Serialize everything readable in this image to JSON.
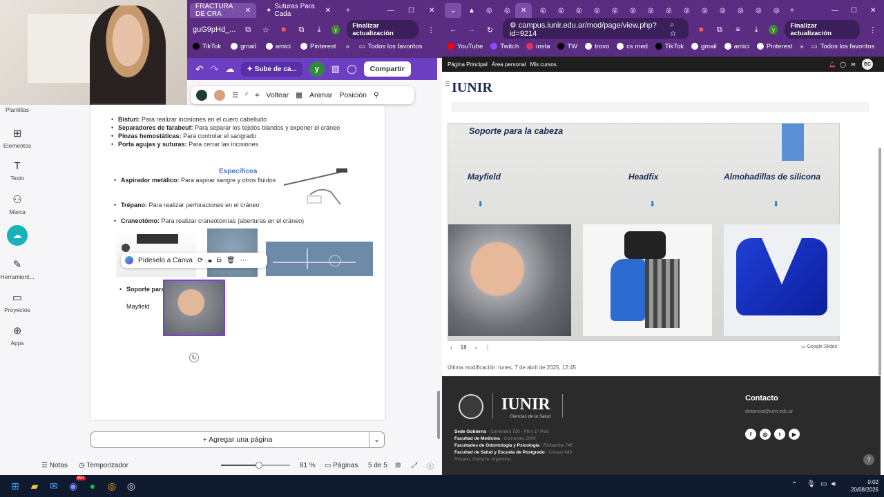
{
  "left_browser": {
    "tabs": [
      {
        "label": "FRACTURA DE CRÁ",
        "active": true
      },
      {
        "label": "Suturas Para Cada",
        "active": false
      }
    ],
    "url_fragment": "guG9pHd_...",
    "update_button": "Finalizar actualización",
    "bookmarks": [
      "TikTok",
      "gmail",
      "amici",
      "Pinterest"
    ],
    "all_bookmarks": "Todos los favoritos"
  },
  "canva": {
    "sube_label": "Sube de ca...",
    "avatar_letter": "y",
    "share_button": "Compartir",
    "toolbar": {
      "flip": "Voltear",
      "animate": "Animar",
      "position": "Posición"
    },
    "colors": [
      "#1f3d33",
      "#d9a07c"
    ],
    "sidebar": [
      {
        "label": "Plantillas",
        "icon": "templates-icon"
      },
      {
        "label": "Elementos",
        "icon": "elements-icon"
      },
      {
        "label": "Texto",
        "icon": "text-icon"
      },
      {
        "label": "Marca",
        "icon": "brand-icon"
      },
      {
        "label": "Herramient...",
        "icon": "tools-icon"
      },
      {
        "label": "Proyectos",
        "icon": "folder-icon"
      },
      {
        "label": "Apps",
        "icon": "apps-icon"
      }
    ],
    "doc": {
      "tools": [
        {
          "term": "Bisturí:",
          "desc": "Para realizar incisiones en el cuero cabelludo"
        },
        {
          "term": "Separadores de farabeuf:",
          "desc": "Para separar los tejidos blandos y exponer el cráneo"
        },
        {
          "term": "Pinzas hemostáticas:",
          "desc": "Para controlar el sangrado"
        },
        {
          "term": "Porta agujas y suturas:",
          "desc": "Para cerrar las incisiones"
        }
      ],
      "specific_heading": "Específicos",
      "specific": [
        {
          "term": "Aspirador metálico:",
          "desc": "Para aspirar sangre y otros fluidos"
        },
        {
          "term": "Trépano:",
          "desc": "Para realizar perforaciones en el cráneo"
        },
        {
          "term": "Craneotómo:",
          "desc": "Para realizar craneotomías (aberturas en el cráneo)"
        }
      ],
      "support_heading": "Soporte para la cabeza",
      "mayfield": "Mayfield"
    },
    "ask_canva": "Pídeselo a Canva",
    "add_page": "+ Agregar una página",
    "status": {
      "notes": "Notas",
      "timer": "Temporizador",
      "zoom": "81 %",
      "zoom_value": 0.81,
      "pages_label": "Páginas",
      "pages": "5 de 5"
    }
  },
  "right_browser": {
    "url": "campus.iunir.edu.ar/mod/page/view.php?id=9214",
    "update_button": "Finalizar actualización",
    "bookmarks": [
      "YouTube",
      "Twitch",
      "insta",
      "TW",
      "trovo",
      "cs med",
      "TikTok",
      "gmail",
      "amici",
      "Pinterest"
    ],
    "all_bookmarks": "Todos los favoritos",
    "nav": [
      "Página Principal",
      "Área personal",
      "Mis cursos"
    ],
    "user_initials": "BC",
    "logo": "IUNIR",
    "slide": {
      "title": "Soporte para la cabeza",
      "labels": [
        "Mayfield",
        "Headfix",
        "Almohadillas de silicona"
      ],
      "page": "18",
      "provider": "Google Slides"
    },
    "last_modified": "Última modificación: lunes, 7 de abril de 2025, 12:45",
    "footer": {
      "logo": "IUNIR",
      "logo_sub": "Ciencias de la Salud",
      "addresses": [
        {
          "name": "Sede Gobierno",
          "addr": "- Corrientes 720 - PB y 1° Piso"
        },
        {
          "name": "Facultad de Medicina",
          "addr": "- Corrientes 2009"
        },
        {
          "name": "Facultades de Odontología y Psicología",
          "addr": "- Riobamba 746"
        },
        {
          "name": "Facultad de Salud y Escuela de Postgrado",
          "addr": "- Crespo 843"
        }
      ],
      "city": "Rosario, Santa fe, Argentina",
      "contact_title": "Contacto",
      "email": "distancia@iunir.edu.ar"
    }
  },
  "taskbar": {
    "time": "0:02",
    "date": "20/08/2026",
    "badge": "99+"
  }
}
